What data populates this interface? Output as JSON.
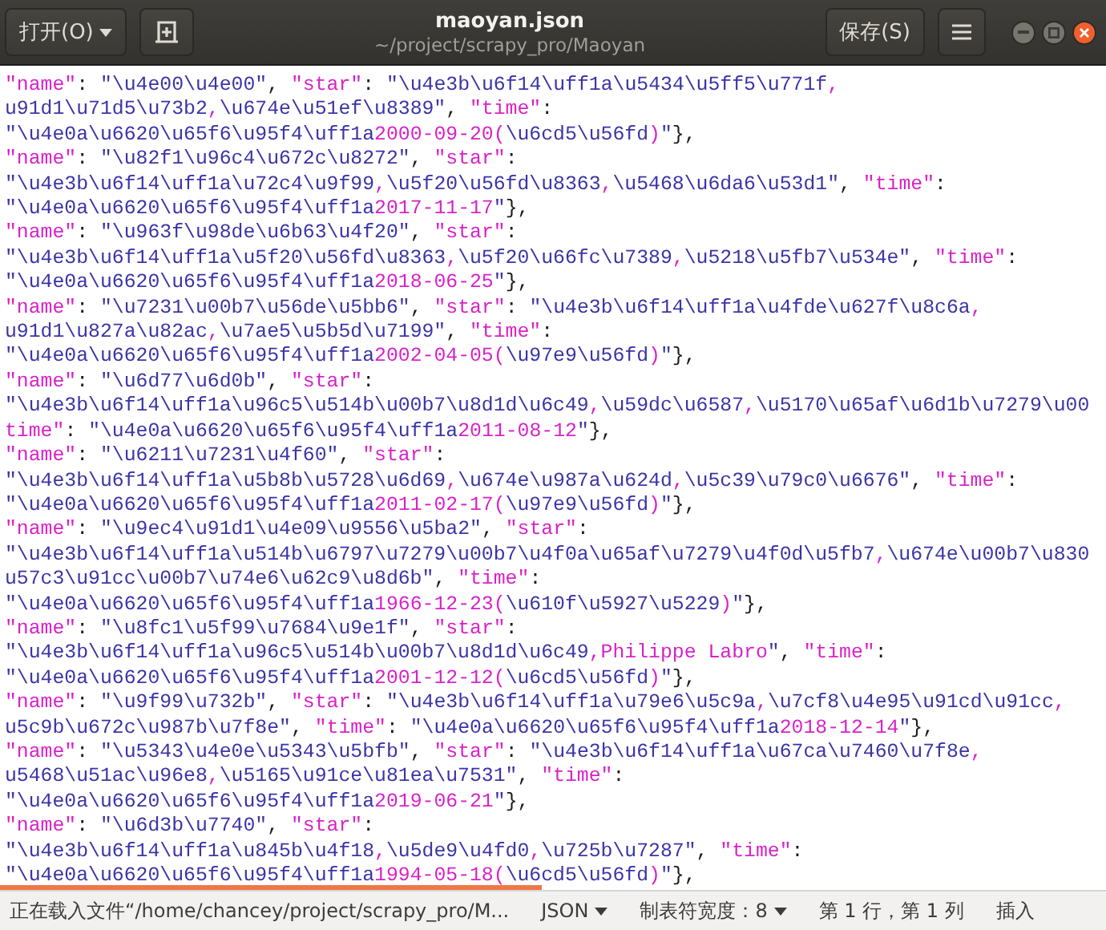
{
  "header": {
    "open_button": "打开(O)",
    "title": "maoyan.json",
    "subtitle": "~/project/scrapy_pro/Maoyan",
    "save_button": "保存(S)"
  },
  "lines": [
    {
      "segments": [
        {
          "kind": "accent",
          "text": "\"name\""
        },
        {
          "kind": "plain",
          "text": ": "
        },
        {
          "kind": "string",
          "text": "\"\\u4e00\\u4e00\""
        },
        {
          "kind": "plain",
          "text": ", "
        },
        {
          "kind": "accent",
          "text": "\"star\""
        },
        {
          "kind": "plain",
          "text": ": "
        },
        {
          "kind": "string",
          "text": "\"\\u4e3b\\u6f14\\uff1a\\u5434\\u5ff5\\u771f"
        },
        {
          "kind": "accent",
          "text": ","
        }
      ]
    },
    {
      "segments": [
        {
          "kind": "string",
          "text": "u91d1\\u71d5\\u73b2"
        },
        {
          "kind": "accent",
          "text": ","
        },
        {
          "kind": "string",
          "text": "\\u674e\\u51ef\\u8389\""
        },
        {
          "kind": "plain",
          "text": ", "
        },
        {
          "kind": "accent",
          "text": "\"time\""
        },
        {
          "kind": "plain",
          "text": ":"
        }
      ]
    },
    {
      "segments": [
        {
          "kind": "string",
          "text": "\"\\u4e0a\\u6620\\u65f6\\u95f4\\uff1a"
        },
        {
          "kind": "accent",
          "text": "2000-09-20("
        },
        {
          "kind": "string",
          "text": "\\u6cd5\\u56fd"
        },
        {
          "kind": "accent",
          "text": ")"
        },
        {
          "kind": "string",
          "text": "\""
        },
        {
          "kind": "plain",
          "text": "},"
        }
      ]
    },
    {
      "segments": [
        {
          "kind": "accent",
          "text": "\"name\""
        },
        {
          "kind": "plain",
          "text": ": "
        },
        {
          "kind": "string",
          "text": "\"\\u82f1\\u96c4\\u672c\\u8272\""
        },
        {
          "kind": "plain",
          "text": ", "
        },
        {
          "kind": "accent",
          "text": "\"star\""
        },
        {
          "kind": "plain",
          "text": ":"
        }
      ]
    },
    {
      "segments": [
        {
          "kind": "string",
          "text": "\"\\u4e3b\\u6f14\\uff1a\\u72c4\\u9f99"
        },
        {
          "kind": "accent",
          "text": ","
        },
        {
          "kind": "string",
          "text": "\\u5f20\\u56fd\\u8363"
        },
        {
          "kind": "accent",
          "text": ","
        },
        {
          "kind": "string",
          "text": "\\u5468\\u6da6\\u53d1\""
        },
        {
          "kind": "plain",
          "text": ", "
        },
        {
          "kind": "accent",
          "text": "\"time\""
        },
        {
          "kind": "plain",
          "text": ":"
        }
      ]
    },
    {
      "segments": [
        {
          "kind": "string",
          "text": "\"\\u4e0a\\u6620\\u65f6\\u95f4\\uff1a"
        },
        {
          "kind": "accent",
          "text": "2017-11-17"
        },
        {
          "kind": "string",
          "text": "\""
        },
        {
          "kind": "plain",
          "text": "},"
        }
      ]
    },
    {
      "segments": [
        {
          "kind": "accent",
          "text": "\"name\""
        },
        {
          "kind": "plain",
          "text": ": "
        },
        {
          "kind": "string",
          "text": "\"\\u963f\\u98de\\u6b63\\u4f20\""
        },
        {
          "kind": "plain",
          "text": ", "
        },
        {
          "kind": "accent",
          "text": "\"star\""
        },
        {
          "kind": "plain",
          "text": ":"
        }
      ]
    },
    {
      "segments": [
        {
          "kind": "string",
          "text": "\"\\u4e3b\\u6f14\\uff1a\\u5f20\\u56fd\\u8363"
        },
        {
          "kind": "accent",
          "text": ","
        },
        {
          "kind": "string",
          "text": "\\u5f20\\u66fc\\u7389"
        },
        {
          "kind": "accent",
          "text": ","
        },
        {
          "kind": "string",
          "text": "\\u5218\\u5fb7\\u534e\""
        },
        {
          "kind": "plain",
          "text": ", "
        },
        {
          "kind": "accent",
          "text": "\"time\""
        },
        {
          "kind": "plain",
          "text": ":"
        }
      ]
    },
    {
      "segments": [
        {
          "kind": "string",
          "text": "\"\\u4e0a\\u6620\\u65f6\\u95f4\\uff1a"
        },
        {
          "kind": "accent",
          "text": "2018-06-25"
        },
        {
          "kind": "string",
          "text": "\""
        },
        {
          "kind": "plain",
          "text": "},"
        }
      ]
    },
    {
      "segments": [
        {
          "kind": "accent",
          "text": "\"name\""
        },
        {
          "kind": "plain",
          "text": ": "
        },
        {
          "kind": "string",
          "text": "\"\\u7231\\u00b7\\u56de\\u5bb6\""
        },
        {
          "kind": "plain",
          "text": ", "
        },
        {
          "kind": "accent",
          "text": "\"star\""
        },
        {
          "kind": "plain",
          "text": ": "
        },
        {
          "kind": "string",
          "text": "\"\\u4e3b\\u6f14\\uff1a\\u4fde\\u627f\\u8c6a"
        },
        {
          "kind": "accent",
          "text": ","
        }
      ]
    },
    {
      "segments": [
        {
          "kind": "string",
          "text": "u91d1\\u827a\\u82ac"
        },
        {
          "kind": "accent",
          "text": ","
        },
        {
          "kind": "string",
          "text": "\\u7ae5\\u5b5d\\u7199\""
        },
        {
          "kind": "plain",
          "text": ", "
        },
        {
          "kind": "accent",
          "text": "\"time\""
        },
        {
          "kind": "plain",
          "text": ":"
        }
      ]
    },
    {
      "segments": [
        {
          "kind": "string",
          "text": "\"\\u4e0a\\u6620\\u65f6\\u95f4\\uff1a"
        },
        {
          "kind": "accent",
          "text": "2002-04-05("
        },
        {
          "kind": "string",
          "text": "\\u97e9\\u56fd"
        },
        {
          "kind": "accent",
          "text": ")"
        },
        {
          "kind": "string",
          "text": "\""
        },
        {
          "kind": "plain",
          "text": "},"
        }
      ]
    },
    {
      "segments": [
        {
          "kind": "accent",
          "text": "\"name\""
        },
        {
          "kind": "plain",
          "text": ": "
        },
        {
          "kind": "string",
          "text": "\"\\u6d77\\u6d0b\""
        },
        {
          "kind": "plain",
          "text": ", "
        },
        {
          "kind": "accent",
          "text": "\"star\""
        },
        {
          "kind": "plain",
          "text": ":"
        }
      ]
    },
    {
      "segments": [
        {
          "kind": "string",
          "text": "\"\\u4e3b\\u6f14\\uff1a\\u96c5\\u514b\\u00b7\\u8d1d\\u6c49"
        },
        {
          "kind": "accent",
          "text": ","
        },
        {
          "kind": "string",
          "text": "\\u59dc\\u6587"
        },
        {
          "kind": "accent",
          "text": ","
        },
        {
          "kind": "string",
          "text": "\\u5170\\u65af\\u6d1b\\u7279\\u00"
        }
      ]
    },
    {
      "segments": [
        {
          "kind": "accent",
          "text": "time\""
        },
        {
          "kind": "plain",
          "text": ": "
        },
        {
          "kind": "string",
          "text": "\"\\u4e0a\\u6620\\u65f6\\u95f4\\uff1a"
        },
        {
          "kind": "accent",
          "text": "2011-08-12"
        },
        {
          "kind": "string",
          "text": "\""
        },
        {
          "kind": "plain",
          "text": "},"
        }
      ]
    },
    {
      "segments": [
        {
          "kind": "accent",
          "text": "\"name\""
        },
        {
          "kind": "plain",
          "text": ": "
        },
        {
          "kind": "string",
          "text": "\"\\u6211\\u7231\\u4f60\""
        },
        {
          "kind": "plain",
          "text": ", "
        },
        {
          "kind": "accent",
          "text": "\"star\""
        },
        {
          "kind": "plain",
          "text": ":"
        }
      ]
    },
    {
      "segments": [
        {
          "kind": "string",
          "text": "\"\\u4e3b\\u6f14\\uff1a\\u5b8b\\u5728\\u6d69"
        },
        {
          "kind": "accent",
          "text": ","
        },
        {
          "kind": "string",
          "text": "\\u674e\\u987a\\u624d"
        },
        {
          "kind": "accent",
          "text": ","
        },
        {
          "kind": "string",
          "text": "\\u5c39\\u79c0\\u6676\""
        },
        {
          "kind": "plain",
          "text": ", "
        },
        {
          "kind": "accent",
          "text": "\"time\""
        },
        {
          "kind": "plain",
          "text": ":"
        }
      ]
    },
    {
      "segments": [
        {
          "kind": "string",
          "text": "\"\\u4e0a\\u6620\\u65f6\\u95f4\\uff1a"
        },
        {
          "kind": "accent",
          "text": "2011-02-17("
        },
        {
          "kind": "string",
          "text": "\\u97e9\\u56fd"
        },
        {
          "kind": "accent",
          "text": ")"
        },
        {
          "kind": "string",
          "text": "\""
        },
        {
          "kind": "plain",
          "text": "},"
        }
      ]
    },
    {
      "segments": [
        {
          "kind": "accent",
          "text": "\"name\""
        },
        {
          "kind": "plain",
          "text": ": "
        },
        {
          "kind": "string",
          "text": "\"\\u9ec4\\u91d1\\u4e09\\u9556\\u5ba2\""
        },
        {
          "kind": "plain",
          "text": ", "
        },
        {
          "kind": "accent",
          "text": "\"star\""
        },
        {
          "kind": "plain",
          "text": ":"
        }
      ]
    },
    {
      "segments": [
        {
          "kind": "string",
          "text": "\"\\u4e3b\\u6f14\\uff1a\\u514b\\u6797\\u7279\\u00b7\\u4f0a\\u65af\\u7279\\u4f0d\\u5fb7"
        },
        {
          "kind": "accent",
          "text": ","
        },
        {
          "kind": "string",
          "text": "\\u674e\\u00b7\\u830"
        }
      ]
    },
    {
      "segments": [
        {
          "kind": "string",
          "text": "u57c3\\u91cc\\u00b7\\u74e6\\u62c9\\u8d6b\""
        },
        {
          "kind": "plain",
          "text": ", "
        },
        {
          "kind": "accent",
          "text": "\"time\""
        },
        {
          "kind": "plain",
          "text": ":"
        }
      ]
    },
    {
      "segments": [
        {
          "kind": "string",
          "text": "\"\\u4e0a\\u6620\\u65f6\\u95f4\\uff1a"
        },
        {
          "kind": "accent",
          "text": "1966-12-23("
        },
        {
          "kind": "string",
          "text": "\\u610f\\u5927\\u5229"
        },
        {
          "kind": "accent",
          "text": ")"
        },
        {
          "kind": "string",
          "text": "\""
        },
        {
          "kind": "plain",
          "text": "},"
        }
      ]
    },
    {
      "segments": [
        {
          "kind": "accent",
          "text": "\"name\""
        },
        {
          "kind": "plain",
          "text": ": "
        },
        {
          "kind": "string",
          "text": "\"\\u8fc1\\u5f99\\u7684\\u9e1f\""
        },
        {
          "kind": "plain",
          "text": ", "
        },
        {
          "kind": "accent",
          "text": "\"star\""
        },
        {
          "kind": "plain",
          "text": ":"
        }
      ]
    },
    {
      "segments": [
        {
          "kind": "string",
          "text": "\"\\u4e3b\\u6f14\\uff1a\\u96c5\\u514b\\u00b7\\u8d1d\\u6c49"
        },
        {
          "kind": "accent",
          "text": ",Philippe Labro"
        },
        {
          "kind": "string",
          "text": "\""
        },
        {
          "kind": "plain",
          "text": ", "
        },
        {
          "kind": "accent",
          "text": "\"time\""
        },
        {
          "kind": "plain",
          "text": ":"
        }
      ]
    },
    {
      "segments": [
        {
          "kind": "string",
          "text": "\"\\u4e0a\\u6620\\u65f6\\u95f4\\uff1a"
        },
        {
          "kind": "accent",
          "text": "2001-12-12("
        },
        {
          "kind": "string",
          "text": "\\u6cd5\\u56fd"
        },
        {
          "kind": "accent",
          "text": ")"
        },
        {
          "kind": "string",
          "text": "\""
        },
        {
          "kind": "plain",
          "text": "},"
        }
      ]
    },
    {
      "segments": [
        {
          "kind": "accent",
          "text": "\"name\""
        },
        {
          "kind": "plain",
          "text": ": "
        },
        {
          "kind": "string",
          "text": "\"\\u9f99\\u732b\""
        },
        {
          "kind": "plain",
          "text": ", "
        },
        {
          "kind": "accent",
          "text": "\"star\""
        },
        {
          "kind": "plain",
          "text": ": "
        },
        {
          "kind": "string",
          "text": "\"\\u4e3b\\u6f14\\uff1a\\u79e6\\u5c9a"
        },
        {
          "kind": "accent",
          "text": ","
        },
        {
          "kind": "string",
          "text": "\\u7cf8\\u4e95\\u91cd\\u91cc"
        },
        {
          "kind": "accent",
          "text": ","
        }
      ]
    },
    {
      "segments": [
        {
          "kind": "string",
          "text": "u5c9b\\u672c\\u987b\\u7f8e\""
        },
        {
          "kind": "plain",
          "text": ", "
        },
        {
          "kind": "accent",
          "text": "\"time\""
        },
        {
          "kind": "plain",
          "text": ": "
        },
        {
          "kind": "string",
          "text": "\"\\u4e0a\\u6620\\u65f6\\u95f4\\uff1a"
        },
        {
          "kind": "accent",
          "text": "2018-12-14"
        },
        {
          "kind": "string",
          "text": "\""
        },
        {
          "kind": "plain",
          "text": "},"
        }
      ]
    },
    {
      "segments": [
        {
          "kind": "accent",
          "text": "\"name\""
        },
        {
          "kind": "plain",
          "text": ": "
        },
        {
          "kind": "string",
          "text": "\"\\u5343\\u4e0e\\u5343\\u5bfb\""
        },
        {
          "kind": "plain",
          "text": ", "
        },
        {
          "kind": "accent",
          "text": "\"star\""
        },
        {
          "kind": "plain",
          "text": ": "
        },
        {
          "kind": "string",
          "text": "\"\\u4e3b\\u6f14\\uff1a\\u67ca\\u7460\\u7f8e"
        },
        {
          "kind": "accent",
          "text": ","
        }
      ]
    },
    {
      "segments": [
        {
          "kind": "string",
          "text": "u5468\\u51ac\\u96e8"
        },
        {
          "kind": "accent",
          "text": ","
        },
        {
          "kind": "string",
          "text": "\\u5165\\u91ce\\u81ea\\u7531\""
        },
        {
          "kind": "plain",
          "text": ", "
        },
        {
          "kind": "accent",
          "text": "\"time\""
        },
        {
          "kind": "plain",
          "text": ":"
        }
      ]
    },
    {
      "segments": [
        {
          "kind": "string",
          "text": "\"\\u4e0a\\u6620\\u65f6\\u95f4\\uff1a"
        },
        {
          "kind": "accent",
          "text": "2019-06-21"
        },
        {
          "kind": "string",
          "text": "\""
        },
        {
          "kind": "plain",
          "text": "},"
        }
      ]
    },
    {
      "segments": [
        {
          "kind": "accent",
          "text": "\"name\""
        },
        {
          "kind": "plain",
          "text": ": "
        },
        {
          "kind": "string",
          "text": "\"\\u6d3b\\u7740\""
        },
        {
          "kind": "plain",
          "text": ", "
        },
        {
          "kind": "accent",
          "text": "\"star\""
        },
        {
          "kind": "plain",
          "text": ":"
        }
      ]
    },
    {
      "segments": [
        {
          "kind": "string",
          "text": "\"\\u4e3b\\u6f14\\uff1a\\u845b\\u4f18"
        },
        {
          "kind": "accent",
          "text": ","
        },
        {
          "kind": "string",
          "text": "\\u5de9\\u4fd0"
        },
        {
          "kind": "accent",
          "text": ","
        },
        {
          "kind": "string",
          "text": "\\u725b\\u7287\""
        },
        {
          "kind": "plain",
          "text": ", "
        },
        {
          "kind": "accent",
          "text": "\"time\""
        },
        {
          "kind": "plain",
          "text": ":"
        }
      ]
    },
    {
      "segments": [
        {
          "kind": "string",
          "text": "\"\\u4e0a\\u6620\\u65f6\\u95f4\\uff1a"
        },
        {
          "kind": "accent",
          "text": "1994-05-18("
        },
        {
          "kind": "string",
          "text": "\\u6cd5\\u56fd"
        },
        {
          "kind": "accent",
          "text": ")"
        },
        {
          "kind": "string",
          "text": "\""
        },
        {
          "kind": "plain",
          "text": "},"
        }
      ]
    }
  ],
  "loading_progress": {
    "level": 0.49
  },
  "status_bar": {
    "message": "正在载入文件“/home/chancey/project/scrapy_pro/M...",
    "language": "JSON",
    "tab_width": "制表符宽度：8",
    "position": "第 1 行，第 1 列",
    "mode": "插入"
  }
}
